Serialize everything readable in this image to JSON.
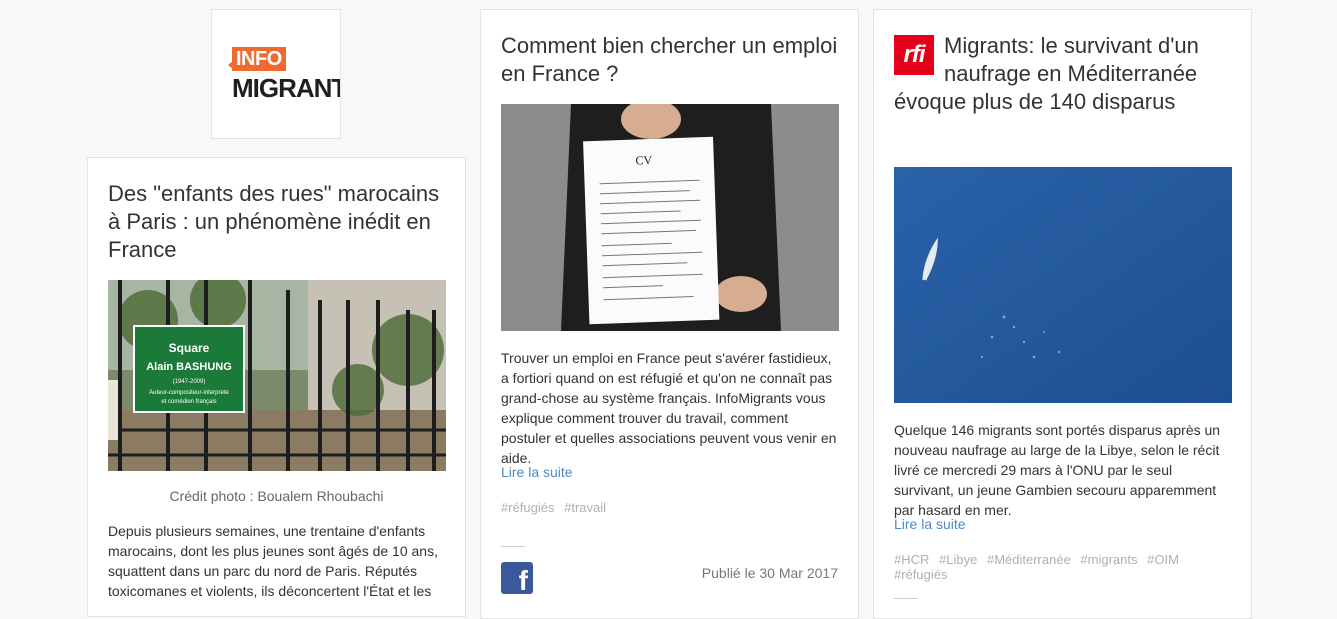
{
  "logo": {
    "badge": "INFO",
    "name": "MIGRANTS"
  },
  "cards": [
    {
      "title": "Des \"enfants des rues\" marocains à Paris : un phénomène inédit en France",
      "image_alt": "Square Alain Bashung sign behind a fence",
      "sign": {
        "line1": "Square",
        "line2": "Alain BASHUNG",
        "line3": "(1947-2009)",
        "line4": "Auteur-compositeur-interprète",
        "line5": "et comédien français"
      },
      "caption": "Crédit photo : Boualem Rhoubachi",
      "excerpt": "Depuis plusieurs semaines, une trentaine d'enfants marocains, dont les plus jeunes sont âgés de 10 ans, squattent dans un parc du nord de Paris. Réputés toxicomanes et violents, ils déconcertent l'État et les"
    },
    {
      "title": "Comment bien chercher un emploi en France ?",
      "cv_label": "CV",
      "excerpt": "Trouver un emploi en France peut s'avérer fastidieux, a fortiori quand on est réfugié et qu'on ne connaît pas grand-chose au système français. InfoMigrants vous explique comment trouver du travail, comment postuler et quelles associations peuvent vous venir en aide.",
      "more": "Lire la suite",
      "tags": [
        "#réfugiés",
        "#travail"
      ],
      "published": "Publié le 30 Mar 2017"
    },
    {
      "source_logo": "rfi",
      "title_line1": "Migrants: le survivant d'un naufrage en Méditerranée",
      "title_line2": "évoque plus de 140 disparus",
      "excerpt": "Quelque 146 migrants sont portés disparus après un nouveau naufrage au large de la Libye, selon le récit livré ce mercredi 29 mars à l'ONU par le seul survivant, un jeune Gambien secouru apparemment par hasard en mer.",
      "more": "Lire la suite",
      "tags": [
        "#HCR",
        "#Libye",
        "#Méditerranée",
        "#migrants",
        "#OIM",
        "#réfugiés"
      ]
    }
  ],
  "colors": {
    "link": "#4f8ac3",
    "facebook": "#3b5998",
    "rfi": "#e4001b",
    "brand_orange": "#ee6a2e"
  }
}
